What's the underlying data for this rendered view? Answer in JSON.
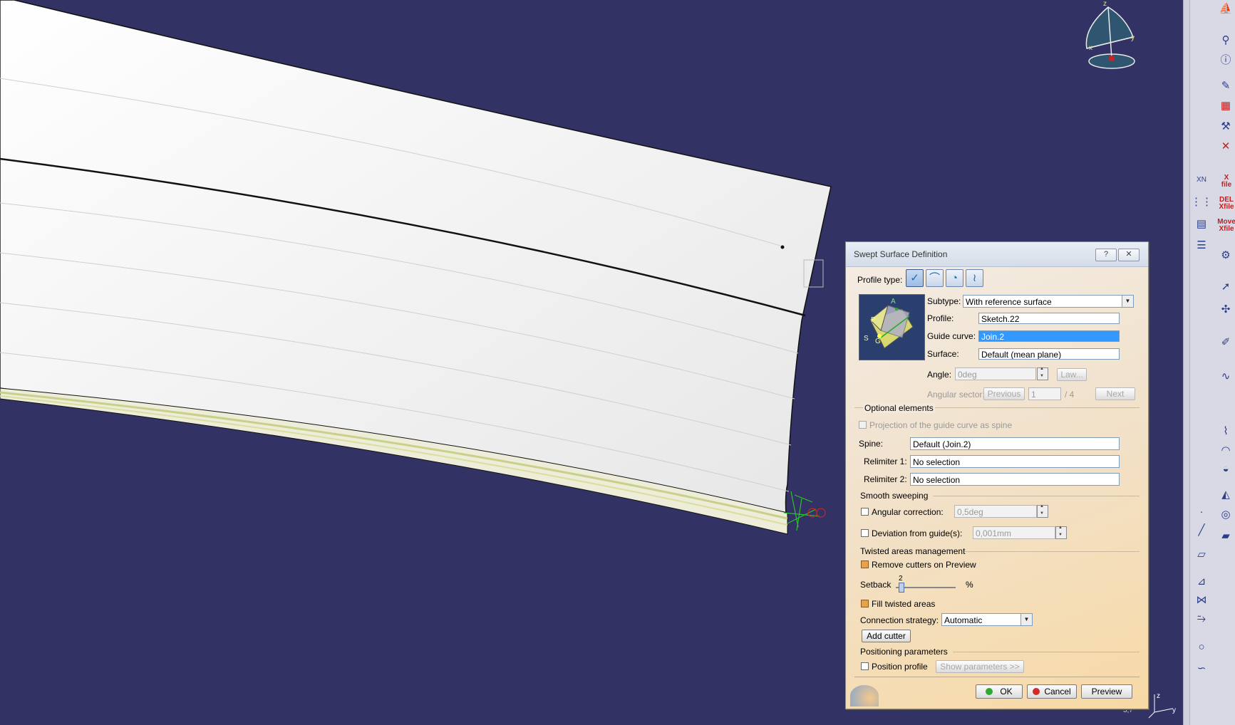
{
  "dialog": {
    "title": "Swept Surface Definition",
    "help_button": "?",
    "close_button": "✕",
    "profile_type_label": "Profile type:",
    "subtype_label": "Subtype:",
    "subtype_value": "With reference surface",
    "profile_label": "Profile:",
    "profile_value": "Sketch.22",
    "guide_curve_label": "Guide curve:",
    "guide_curve_value": "Join.2",
    "surface_label": "Surface:",
    "surface_value": "Default (mean plane)",
    "angle_label": "Angle:",
    "angle_value": "0deg",
    "law_button": "Law...",
    "angular_sector_label": "Angular sector:",
    "previous_button": "Previous",
    "sector_value": "1",
    "sector_total": "/ 4",
    "next_button": "Next",
    "optional_elements_label": "Optional elements",
    "projection_label": "Projection of the guide curve as spine",
    "spine_label": "Spine:",
    "spine_value": "Default (Join.2)",
    "relimiter1_label": "Relimiter 1:",
    "relimiter1_value": "No selection",
    "relimiter2_label": "Relimiter 2:",
    "relimiter2_value": "No selection",
    "smooth_sweeping_label": "Smooth sweeping",
    "angular_correction_label": "Angular correction:",
    "angular_correction_value": "0,5deg",
    "deviation_label": "Deviation from guide(s):",
    "deviation_value": "0,001mm",
    "twisted_areas_label": "Twisted areas management",
    "remove_cutters_label": "Remove cutters on Preview",
    "setback_label": "Setback",
    "setback_value": "2",
    "setback_unit": "%",
    "fill_twisted_label": "Fill twisted areas",
    "connection_strategy_label": "Connection strategy:",
    "connection_strategy_value": "Automatic",
    "add_cutter_button": "Add cutter",
    "positioning_parameters_label": "Positioning parameters",
    "position_profile_label": "Position profile",
    "show_parameters_button": "Show parameters >>",
    "ok_button": "OK",
    "cancel_button": "Cancel",
    "preview_button": "Preview",
    "image_letters": [
      "A",
      "P",
      "S",
      "G"
    ]
  },
  "compass": {
    "axis_x": "x",
    "axis_y": "y",
    "axis_z": "z"
  },
  "axis_triad": {
    "axis_z": "z",
    "axis_y": "y"
  },
  "corner_readout": "3,7",
  "toolbar": {
    "xfile_label": "X\nfile",
    "del_xfile_label": "DEL\nXfile",
    "move_xfile_label": "Move\nXfile",
    "xn_label": "XN"
  },
  "colors": {
    "background": "#323264",
    "surface": "#f2f2f2",
    "selection": "#3399ff"
  }
}
